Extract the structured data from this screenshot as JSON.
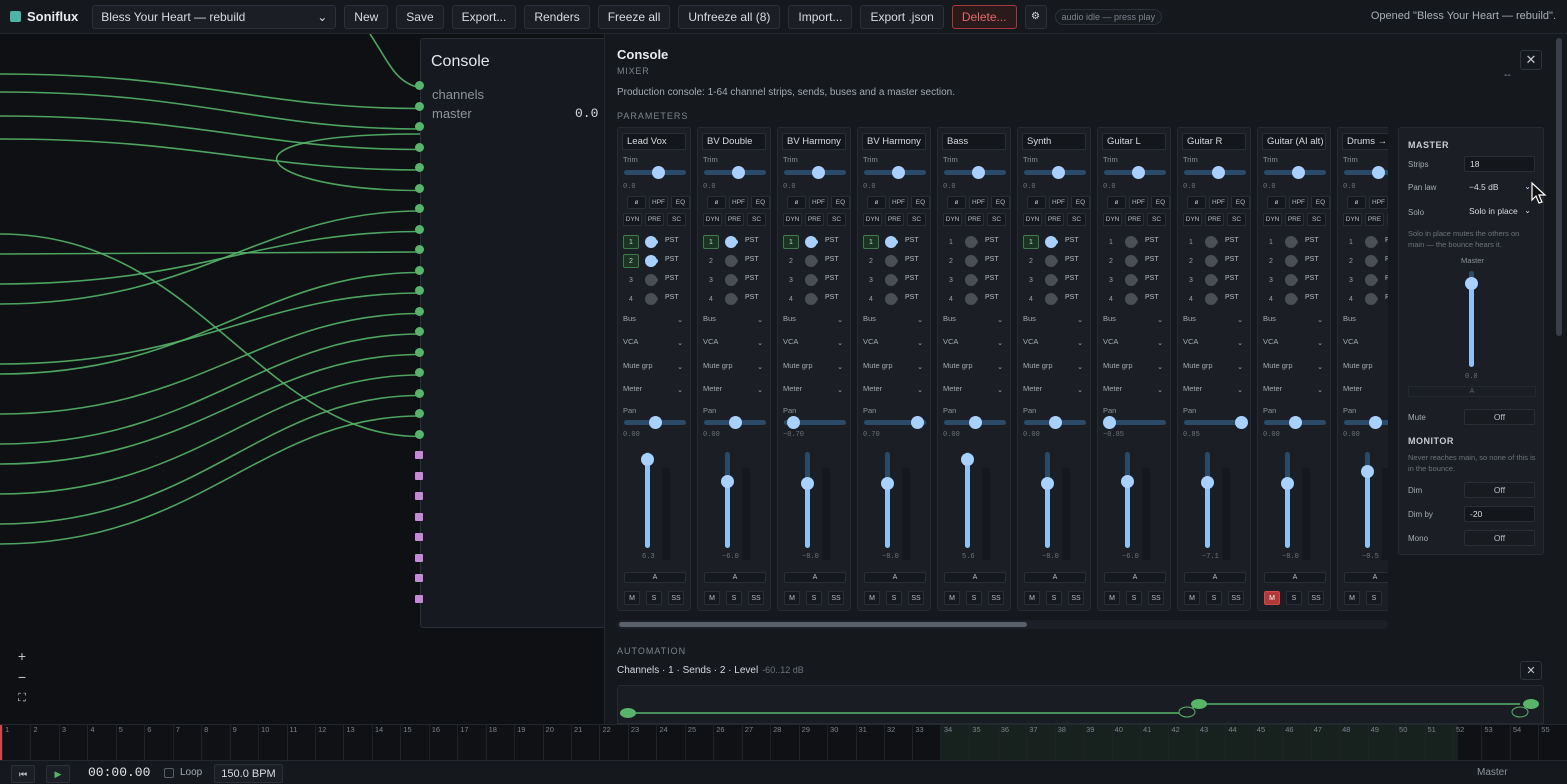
{
  "app": {
    "name": "Soniflux"
  },
  "toolbar": {
    "project": "Bless Your Heart — rebuild",
    "new": "New",
    "save": "Save",
    "export": "Export...",
    "renders": "Renders",
    "freeze_all": "Freeze all",
    "unfreeze_all": "Unfreeze all (8)",
    "import": "Import...",
    "export_json": "Export .json",
    "delete": "Delete...",
    "settings_icon": "gear-icon",
    "audio_status": "audio idle — press play",
    "toast": "Opened \"Bless Your Heart — rebuild\"."
  },
  "node": {
    "title": "Console",
    "rows": [
      "channels",
      "master"
    ],
    "master_value": "0.0"
  },
  "canvas_controls": {
    "zoom_in": "+",
    "zoom_out": "−",
    "fit": "⛶"
  },
  "panel": {
    "title": "Console",
    "subtitle": "MIXER",
    "close": "✕",
    "dash": "--",
    "description": "Production console: 1-64 channel strips, sends, buses and a master section.",
    "parameters_heading": "PARAMETERS",
    "automation_heading": "AUTOMATION"
  },
  "strip_labels": {
    "trim": "Trim",
    "pan": "Pan",
    "bus": "Bus",
    "vca": "VCA",
    "mute_grp": "Mute grp",
    "meter": "Meter",
    "phase": "ø",
    "hpf": "HPF",
    "eq": "EQ",
    "dyn": "DYN",
    "pre": "PRE",
    "sc": "SC",
    "pst": "PST",
    "ab": "A",
    "m": "M",
    "s": "S",
    "ss": "SS"
  },
  "strips": [
    {
      "name": "Lead Vox",
      "trim_val": "0.0",
      "trim": 0.55,
      "pan_val": "0.00",
      "pan": 0.5,
      "fader": 0.93,
      "fader_val": "6.3",
      "sends_on": [
        true,
        true,
        false,
        false
      ],
      "muted": false
    },
    {
      "name": "BV Double",
      "trim_val": "0.0",
      "trim": 0.55,
      "pan_val": "0.00",
      "pan": 0.5,
      "fader": 0.7,
      "fader_val": "−6.0",
      "sends_on": [
        true,
        false,
        false,
        false
      ],
      "muted": false
    },
    {
      "name": "BV Harmony",
      "trim_val": "0.0",
      "trim": 0.55,
      "pan_val": "−0.70",
      "pan": 0.15,
      "fader": 0.68,
      "fader_val": "−8.0",
      "sends_on": [
        true,
        false,
        false,
        false
      ],
      "muted": false
    },
    {
      "name": "BV Harmony",
      "trim_val": "0.0",
      "trim": 0.55,
      "pan_val": "0.70",
      "pan": 0.85,
      "fader": 0.68,
      "fader_val": "−8.0",
      "sends_on": [
        true,
        false,
        false,
        false
      ],
      "muted": false
    },
    {
      "name": "Bass",
      "trim_val": "0.0",
      "trim": 0.55,
      "pan_val": "0.00",
      "pan": 0.5,
      "fader": 0.93,
      "fader_val": "5.6",
      "sends_on": [
        false,
        false,
        false,
        false
      ],
      "muted": false
    },
    {
      "name": "Synth",
      "trim_val": "0.0",
      "trim": 0.55,
      "pan_val": "0.00",
      "pan": 0.5,
      "fader": 0.68,
      "fader_val": "−8.0",
      "sends_on": [
        true,
        false,
        false,
        false
      ],
      "muted": false
    },
    {
      "name": "Guitar L",
      "trim_val": "0.0",
      "trim": 0.55,
      "pan_val": "−0.85",
      "pan": 0.08,
      "fader": 0.7,
      "fader_val": "−6.0",
      "sends_on": [
        false,
        false,
        false,
        false
      ],
      "muted": false
    },
    {
      "name": "Guitar R",
      "trim_val": "0.0",
      "trim": 0.55,
      "pan_val": "0.85",
      "pan": 0.92,
      "fader": 0.69,
      "fader_val": "−7.1",
      "sends_on": [
        false,
        false,
        false,
        false
      ],
      "muted": false
    },
    {
      "name": "Guitar (AI alt)",
      "trim_val": "0.0",
      "trim": 0.55,
      "pan_val": "0.00",
      "pan": 0.5,
      "fader": 0.68,
      "fader_val": "−8.0",
      "sends_on": [
        false,
        false,
        false,
        false
      ],
      "muted": true
    },
    {
      "name": "Drums →",
      "trim_val": "0.0",
      "trim": 0.55,
      "pan_val": "0.00",
      "pan": 0.5,
      "fader": 0.8,
      "fader_val": "−0.5",
      "sends_on": [
        false,
        false,
        false,
        false
      ],
      "muted": false
    }
  ],
  "master": {
    "heading": "MASTER",
    "strips_label": "Strips",
    "strips_value": "18",
    "pan_law_label": "Pan law",
    "pan_law_value": "−4.5 dB",
    "solo_label": "Solo",
    "solo_value": "Solo in place",
    "solo_note": "Solo in place mutes the others on main — the bounce hears it.",
    "fader_label": "Master",
    "fader": 0.88,
    "fader_val": "0.0",
    "ab": "A",
    "mute_label": "Mute",
    "mute_value": "Off",
    "monitor_heading": "MONITOR",
    "monitor_note": "Never reaches main, so none of this is in the bounce.",
    "dim_label": "Dim",
    "dim_value": "Off",
    "dim_by_label": "Dim by",
    "dim_by_value": "-20",
    "mono_label": "Mono",
    "mono_value": "Off"
  },
  "automation": {
    "path": "Channels · 1 · Sends · 2 · Level",
    "range": "-60..12 dB",
    "close": "✕"
  },
  "ruler": {
    "bars": [
      1,
      2,
      3,
      4,
      5,
      6,
      7,
      8,
      9,
      10,
      11,
      12,
      13,
      14,
      15,
      16,
      17,
      18,
      19,
      20,
      21,
      22,
      23,
      24,
      25,
      26,
      27,
      28,
      29,
      30,
      31,
      32,
      33,
      34,
      35,
      36,
      37,
      38,
      39,
      40,
      41,
      42,
      43,
      44,
      45,
      46,
      47,
      48,
      49,
      50,
      51,
      52,
      53,
      54,
      55
    ]
  },
  "transport": {
    "rewind": "⏮",
    "play": "▶",
    "time": "00:00.00",
    "loop": "Loop",
    "bpm": "150.0 BPM",
    "output": "Master"
  },
  "colors": {
    "accent": "#a8d1ff",
    "wire": "#57b46a",
    "danger": "#d04848"
  }
}
